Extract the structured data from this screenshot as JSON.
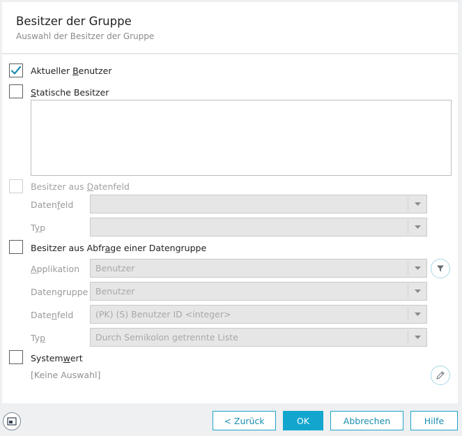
{
  "dialog": {
    "title": "Besitzer der Gruppe",
    "subtitle": "Auswahl der Besitzer der Gruppe"
  },
  "options": {
    "current_user": {
      "pre": "Aktueller ",
      "ul": "B",
      "post": "enutzer",
      "checked": true
    },
    "static_owners": {
      "pre": "",
      "ul": "S",
      "post": "tatische Besitzer",
      "checked": false,
      "text_value": ""
    },
    "owners_from_field": {
      "pre": "Besitzer aus ",
      "ul": "D",
      "post": "atenfeld",
      "checked": false,
      "enabled": false
    },
    "owners_from_query": {
      "pre": "Besitzer aus Abfr",
      "ul": "a",
      "post": "ge einer Datengruppe",
      "checked": false
    },
    "system_value": {
      "pre": "System",
      "ul": "w",
      "post": "ert",
      "checked": false,
      "selection": "[Keine Auswahl]"
    }
  },
  "field_section": {
    "datenfeld": {
      "pre": "Daten",
      "ul": "f",
      "post": "eld",
      "value": ""
    },
    "typ": {
      "pre": "T",
      "ul": "y",
      "post": "p",
      "value": ""
    }
  },
  "query_section": {
    "applikation": {
      "pre": "",
      "ul": "A",
      "post": "pplikation",
      "value": "Benutzer"
    },
    "datengruppe": {
      "pre": "Daten",
      "ul": "g",
      "post": "ruppe",
      "value": "Benutzer"
    },
    "datenfeld": {
      "pre": "Date",
      "ul": "n",
      "post": "feld",
      "value": "(PK) (S) Benutzer ID <integer>"
    },
    "typ": {
      "pre": "Ty",
      "ul": "p",
      "post": "",
      "value": "Durch Semikolon getrennte Liste"
    }
  },
  "buttons": {
    "back": "< Zurück",
    "ok": "OK",
    "cancel": "Abbrechen",
    "help": "Hilfe"
  },
  "icons": {
    "filter": "filter-icon",
    "edit": "pencil-icon",
    "window": "window-icon",
    "check": "checkmark-icon",
    "dropdown": "caret-down-icon"
  },
  "colors": {
    "accent": "#12a6cf",
    "check": "#1a8db0"
  }
}
